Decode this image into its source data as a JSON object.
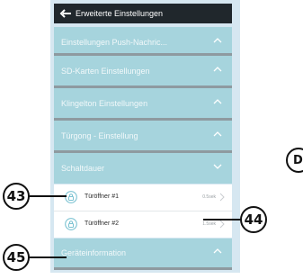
{
  "header": {
    "title": "Erweiterte Einstellungen",
    "back_icon": "back-arrow-icon"
  },
  "sections": [
    {
      "label": "Einstellungen Push-Nachric...",
      "state": "collapsed"
    },
    {
      "label": "SD-Karten Einstellungen",
      "state": "collapsed"
    },
    {
      "label": "Klingelton Einstellungen",
      "state": "collapsed"
    },
    {
      "label": "Türgong - Einstellung",
      "state": "collapsed"
    },
    {
      "label": "Schaltdauer",
      "state": "expanded"
    }
  ],
  "schaltdauer_items": [
    {
      "name": "Türöffner #1",
      "value": "0.5sek"
    },
    {
      "name": "Türöffner #2",
      "value": "1.5sek"
    }
  ],
  "footer_section": {
    "label": "Geräteinformation",
    "state": "collapsed"
  },
  "callouts": {
    "c43": "43",
    "c44": "44",
    "c45": "45",
    "edge": "D"
  },
  "colors": {
    "header_bg": "#20272c",
    "section_bg": "#a6d4dd",
    "screen_bg": "#d6e7f1"
  }
}
